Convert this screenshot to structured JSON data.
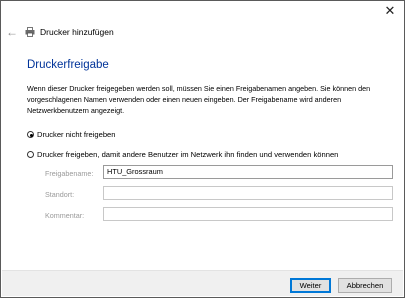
{
  "window": {
    "title": "Drucker hinzufügen",
    "close_symbol": "✕",
    "back_symbol": "←",
    "icons": {
      "title": "printer-icon",
      "back": "back-arrow-icon",
      "close": "close-icon"
    }
  },
  "page": {
    "heading": "Druckerfreigabe",
    "description": "Wenn dieser Drucker freigegeben werden soll, müssen Sie einen Freigabenamen angeben. Sie können den vorgeschlagenen Namen verwenden oder einen neuen eingeben. Der Freigabename wird anderen Netzwerkbenutzern angezeigt."
  },
  "options": {
    "no_share": {
      "label": "Drucker nicht freigeben",
      "selected": true
    },
    "share": {
      "label": "Drucker freigeben, damit andere Benutzer im Netzwerk ihn finden und verwenden können",
      "selected": false
    }
  },
  "fields": {
    "share_name": {
      "label": "Freigabename:",
      "value": "HTU_Grossraum"
    },
    "location": {
      "label": "Standort:",
      "value": ""
    },
    "comment": {
      "label": "Kommentar:",
      "value": ""
    }
  },
  "buttons": {
    "next": "Weiter",
    "cancel": "Abbrechen"
  },
  "colors": {
    "heading": "#003399",
    "primary_border": "#0078d7",
    "footer_bg": "#f0f0f0"
  }
}
